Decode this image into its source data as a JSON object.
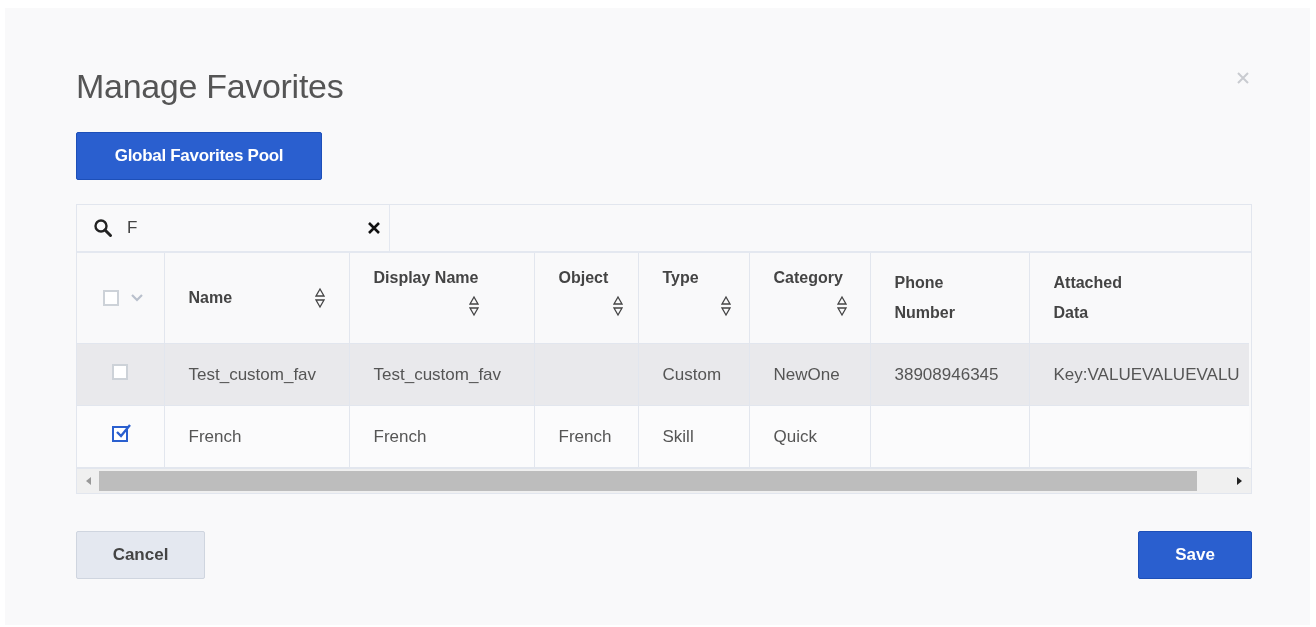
{
  "dialog": {
    "title": "Manage Favorites"
  },
  "pool_button": "Global Favorites Pool",
  "search": {
    "value": "F"
  },
  "table": {
    "select_all": {
      "checked": false
    },
    "columns": [
      {
        "label": "Name",
        "sortable": true
      },
      {
        "label": "Display Name",
        "sortable": true
      },
      {
        "label": "Object",
        "sortable": true
      },
      {
        "label": "Type",
        "sortable": true
      },
      {
        "label": "Category",
        "sortable": true
      },
      {
        "label": "Phone Number",
        "sortable": false
      },
      {
        "label": "Attached Data",
        "sortable": false
      }
    ],
    "rows": [
      {
        "checked": false,
        "highlighted": true,
        "cells": [
          "Test_custom_fav",
          "Test_custom_fav",
          "",
          "Custom",
          "NewOne",
          "38908946345",
          "Key:VALUEVALUEVALU"
        ]
      },
      {
        "checked": true,
        "highlighted": false,
        "cells": [
          "French",
          "French",
          "French",
          "Skill",
          "Quick",
          "",
          ""
        ]
      }
    ]
  },
  "buttons": {
    "cancel": "Cancel",
    "save": "Save"
  }
}
